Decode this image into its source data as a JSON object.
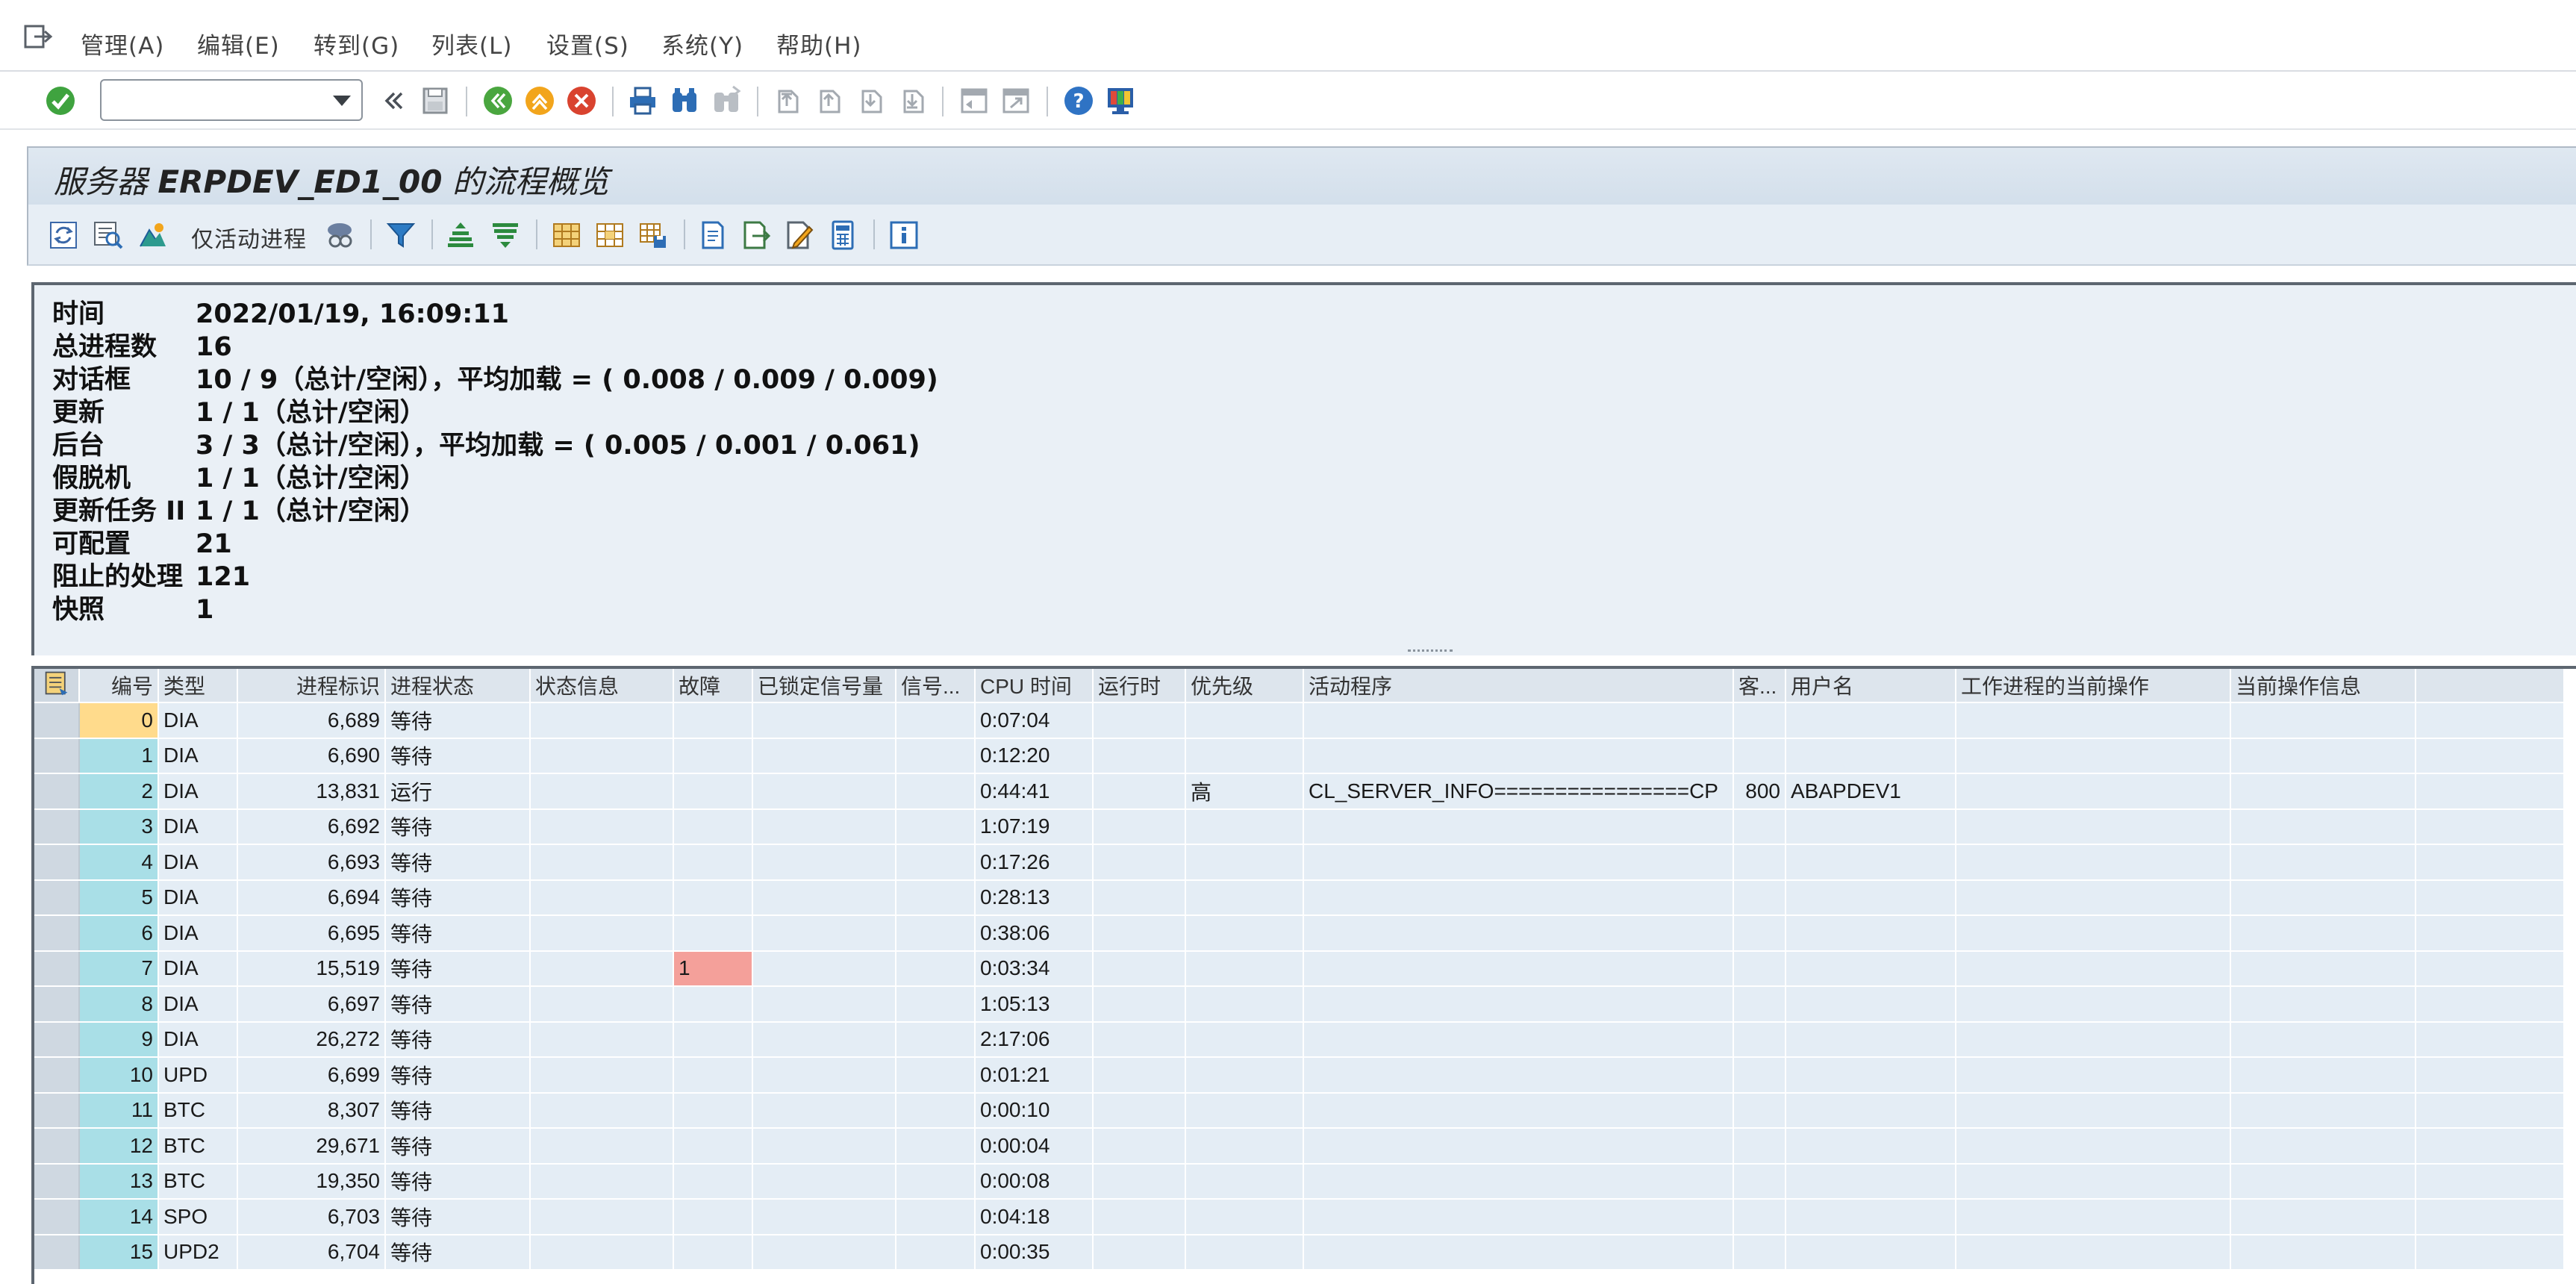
{
  "menu": {
    "items": [
      "管理(A)",
      "编辑(E)",
      "转到(G)",
      "列表(L)",
      "设置(S)",
      "系统(Y)",
      "帮助(H)"
    ]
  },
  "toolbar": {
    "command_field_value": "",
    "icons": [
      "enter-icon",
      "back-icon",
      "save-icon",
      "exit-icon",
      "cancel-icon",
      "print-icon",
      "find-icon",
      "find-next-icon",
      "first-page-icon",
      "previous-page-icon",
      "next-page-icon",
      "last-page-icon",
      "new-session-icon",
      "shortcut-icon",
      "help-icon",
      "customize-layout-icon"
    ]
  },
  "title": {
    "prefix": "服务器",
    "server": "ERPDEV_ED1_00",
    "suffix": "的流程概览"
  },
  "app_toolbar": {
    "active_only_label": "仅活动进程"
  },
  "info": {
    "rows": [
      {
        "label": "时间",
        "value": "2022/01/19, 16:09:11"
      },
      {
        "label": "总进程数",
        "value": "16"
      },
      {
        "label": "对话框",
        "value": "10 / 9（总计/空闲），平均加载 = ( 0.008 / 0.009 / 0.009)"
      },
      {
        "label": "更新",
        "value": "1 / 1（总计/空闲）"
      },
      {
        "label": "后台",
        "value": "3 / 3（总计/空闲），平均加载 = ( 0.005 / 0.001 / 0.061)"
      },
      {
        "label": "假脱机",
        "value": "1 / 1（总计/空闲）"
      },
      {
        "label": "更新任务 II",
        "value": "1 / 1（总计/空闲）"
      },
      {
        "label": "可配置",
        "value": "21"
      },
      {
        "label": "阻止的处理",
        "value": "121"
      },
      {
        "label": "快照",
        "value": "1"
      }
    ]
  },
  "grid": {
    "columns": [
      "编号",
      "类型",
      "进程标识",
      "进程状态",
      "状态信息",
      "故障",
      "已锁定信号量",
      "信号...",
      "CPU 时间",
      "运行时",
      "优先级",
      "活动程序",
      "客...",
      "用户名",
      "工作进程的当前操作",
      "当前操作信息"
    ],
    "rows": [
      [
        "0",
        "DIA",
        "6,689",
        "等待",
        "",
        "",
        "",
        "",
        "0:07:04",
        "",
        "",
        "",
        "",
        "",
        "",
        ""
      ],
      [
        "1",
        "DIA",
        "6,690",
        "等待",
        "",
        "",
        "",
        "",
        "0:12:20",
        "",
        "",
        "",
        "",
        "",
        "",
        ""
      ],
      [
        "2",
        "DIA",
        "13,831",
        "运行",
        "",
        "",
        "",
        "",
        "0:44:41",
        "",
        "高",
        "CL_SERVER_INFO================CP",
        "800",
        "ABAPDEV1",
        "",
        ""
      ],
      [
        "3",
        "DIA",
        "6,692",
        "等待",
        "",
        "",
        "",
        "",
        "1:07:19",
        "",
        "",
        "",
        "",
        "",
        "",
        ""
      ],
      [
        "4",
        "DIA",
        "6,693",
        "等待",
        "",
        "",
        "",
        "",
        "0:17:26",
        "",
        "",
        "",
        "",
        "",
        "",
        ""
      ],
      [
        "5",
        "DIA",
        "6,694",
        "等待",
        "",
        "",
        "",
        "",
        "0:28:13",
        "",
        "",
        "",
        "",
        "",
        "",
        ""
      ],
      [
        "6",
        "DIA",
        "6,695",
        "等待",
        "",
        "",
        "",
        "",
        "0:38:06",
        "",
        "",
        "",
        "",
        "",
        "",
        ""
      ],
      [
        "7",
        "DIA",
        "15,519",
        "等待",
        "",
        "1",
        "",
        "",
        "0:03:34",
        "",
        "",
        "",
        "",
        "",
        "",
        ""
      ],
      [
        "8",
        "DIA",
        "6,697",
        "等待",
        "",
        "",
        "",
        "",
        "1:05:13",
        "",
        "",
        "",
        "",
        "",
        "",
        ""
      ],
      [
        "9",
        "DIA",
        "26,272",
        "等待",
        "",
        "",
        "",
        "",
        "2:17:06",
        "",
        "",
        "",
        "",
        "",
        "",
        ""
      ],
      [
        "10",
        "UPD",
        "6,699",
        "等待",
        "",
        "",
        "",
        "",
        "0:01:21",
        "",
        "",
        "",
        "",
        "",
        "",
        ""
      ],
      [
        "11",
        "BTC",
        "8,307",
        "等待",
        "",
        "",
        "",
        "",
        "0:00:10",
        "",
        "",
        "",
        "",
        "",
        "",
        ""
      ],
      [
        "12",
        "BTC",
        "29,671",
        "等待",
        "",
        "",
        "",
        "",
        "0:00:04",
        "",
        "",
        "",
        "",
        "",
        "",
        ""
      ],
      [
        "13",
        "BTC",
        "19,350",
        "等待",
        "",
        "",
        "",
        "",
        "0:00:08",
        "",
        "",
        "",
        "",
        "",
        "",
        ""
      ],
      [
        "14",
        "SPO",
        "6,703",
        "等待",
        "",
        "",
        "",
        "",
        "0:04:18",
        "",
        "",
        "",
        "",
        "",
        "",
        ""
      ],
      [
        "15",
        "UPD2",
        "6,704",
        "等待",
        "",
        "",
        "",
        "",
        "0:00:35",
        "",
        "",
        "",
        "",
        "",
        "",
        ""
      ]
    ]
  },
  "colors": {
    "key_cell": "#a9dfe7",
    "current_key_cell": "#ffdb8c",
    "error_cell": "#f4a09a",
    "grid_cell": "#e4edf5",
    "header_bg": "#dde5ed",
    "title_bg": "#d9e4ef"
  }
}
